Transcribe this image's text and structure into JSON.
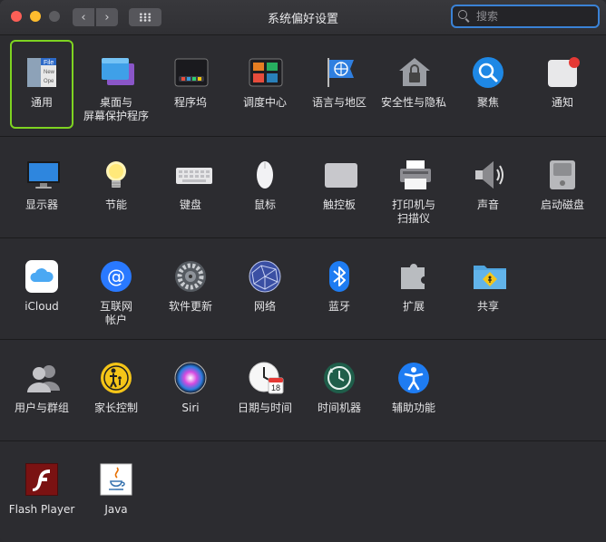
{
  "window": {
    "title": "系统偏好设置"
  },
  "search": {
    "placeholder": "搜索"
  },
  "toolbar": {
    "back_glyph": "‹",
    "forward_glyph": "›"
  },
  "rows": [
    {
      "items": [
        {
          "label": "通用",
          "icon": "general-icon",
          "selected": true,
          "file_text": [
            "File",
            "New",
            "Ope"
          ]
        },
        {
          "label": "桌面与\n屏幕保护程序",
          "icon": "desktop-screensaver-icon"
        },
        {
          "label": "程序坞",
          "icon": "dock-icon"
        },
        {
          "label": "调度中心",
          "icon": "mission-control-icon"
        },
        {
          "label": "语言与地区",
          "icon": "language-region-icon"
        },
        {
          "label": "安全性与隐私",
          "icon": "security-privacy-icon"
        },
        {
          "label": "聚焦",
          "icon": "spotlight-icon"
        },
        {
          "label": "通知",
          "icon": "notifications-icon"
        }
      ]
    },
    {
      "items": [
        {
          "label": "显示器",
          "icon": "displays-icon"
        },
        {
          "label": "节能",
          "icon": "energy-saver-icon"
        },
        {
          "label": "键盘",
          "icon": "keyboard-icon"
        },
        {
          "label": "鼠标",
          "icon": "mouse-icon"
        },
        {
          "label": "触控板",
          "icon": "trackpad-icon"
        },
        {
          "label": "打印机与\n扫描仪",
          "icon": "printers-scanners-icon"
        },
        {
          "label": "声音",
          "icon": "sound-icon"
        },
        {
          "label": "启动磁盘",
          "icon": "startup-disk-icon"
        }
      ]
    },
    {
      "items": [
        {
          "label": "iCloud",
          "icon": "icloud-icon"
        },
        {
          "label": "互联网\n帐户",
          "icon": "internet-accounts-icon"
        },
        {
          "label": "软件更新",
          "icon": "software-update-icon"
        },
        {
          "label": "网络",
          "icon": "network-icon"
        },
        {
          "label": "蓝牙",
          "icon": "bluetooth-icon"
        },
        {
          "label": "扩展",
          "icon": "extensions-icon"
        },
        {
          "label": "共享",
          "icon": "sharing-icon"
        }
      ]
    },
    {
      "items": [
        {
          "label": "用户与群组",
          "icon": "users-groups-icon"
        },
        {
          "label": "家长控制",
          "icon": "parental-controls-icon"
        },
        {
          "label": "Siri",
          "icon": "siri-icon"
        },
        {
          "label": "日期与时间",
          "icon": "date-time-icon",
          "calendar_day": "18"
        },
        {
          "label": "时间机器",
          "icon": "time-machine-icon"
        },
        {
          "label": "辅助功能",
          "icon": "accessibility-icon"
        }
      ]
    },
    {
      "items": [
        {
          "label": "Flash Player",
          "icon": "flash-player-icon"
        },
        {
          "label": "Java",
          "icon": "java-icon"
        }
      ]
    }
  ],
  "colors": {
    "selection": "#7ed321",
    "search_focus": "#3a82d6",
    "background": "#2c2c30"
  }
}
